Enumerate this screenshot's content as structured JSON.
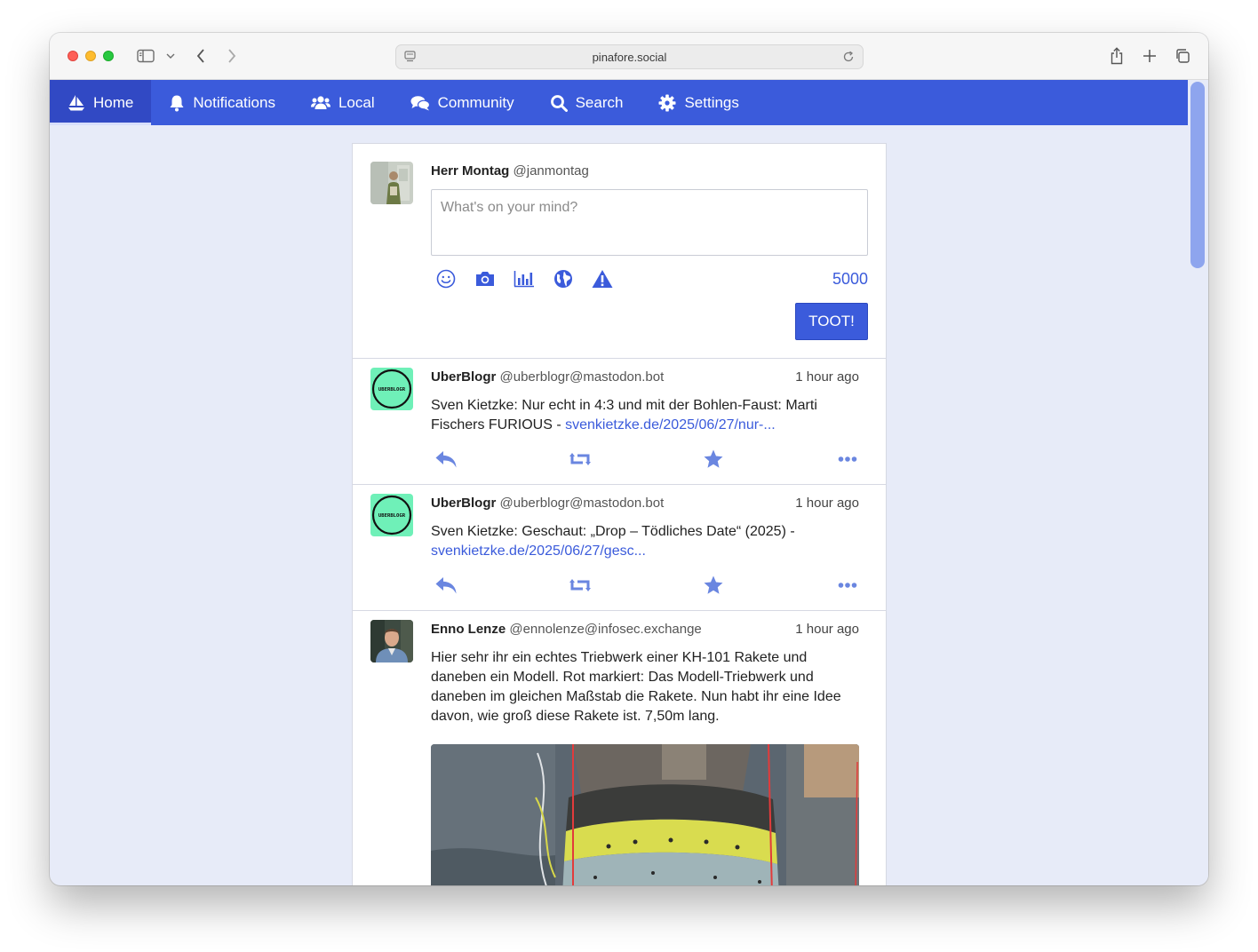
{
  "browser": {
    "url": "pinafore.social"
  },
  "nav": {
    "items": [
      {
        "label": "Home",
        "icon": "sailboat-icon",
        "active": true
      },
      {
        "label": "Notifications",
        "icon": "bell-icon"
      },
      {
        "label": "Local",
        "icon": "users-icon"
      },
      {
        "label": "Community",
        "icon": "comments-icon"
      },
      {
        "label": "Search",
        "icon": "search-icon"
      },
      {
        "label": "Settings",
        "icon": "gear-icon"
      }
    ]
  },
  "compose": {
    "name": "Herr Montag",
    "handle": "@janmontag",
    "placeholder": "What's on your mind?",
    "char_count": "5000",
    "toot_label": "TOOT!",
    "tools": [
      "emoji-icon",
      "camera-icon",
      "poll-icon",
      "globe-icon",
      "warning-icon"
    ]
  },
  "statuses": [
    {
      "name": "UberBlogr",
      "handle": "@uberblogr@mastodon.bot",
      "time": "1 hour ago",
      "text": "Sven Kietzke: Nur echt in 4:3 und mit der Bohlen-Faust: Marti Fischers FURIOUS - ",
      "link": "svenkietzke.de/2025/06/27/nur-...",
      "avatar_label": "UBERBLOGR"
    },
    {
      "name": "UberBlogr",
      "handle": "@uberblogr@mastodon.bot",
      "time": "1 hour ago",
      "text": "Sven Kietzke: Geschaut: „Drop – Tödliches Date“ (2025) - ",
      "link": "svenkietzke.de/2025/06/27/gesc...",
      "avatar_label": "UBERBLOGR"
    },
    {
      "name": "Enno Lenze",
      "handle": "@ennolenze@infosec.exchange",
      "time": "1 hour ago",
      "text": "Hier sehr ihr ein echtes Triebwerk einer KH-101 Rakete und daneben ein Modell. Rot markiert: Das Modell-Triebwerk und daneben im gleichen Maßstab die Rakete. Nun habt ihr eine Idee davon, wie groß diese Rakete ist. 7,50m lang."
    }
  ],
  "colors": {
    "accent": "#3b5bdb",
    "background": "#e7ebf8",
    "icon": "#6a86e0"
  }
}
